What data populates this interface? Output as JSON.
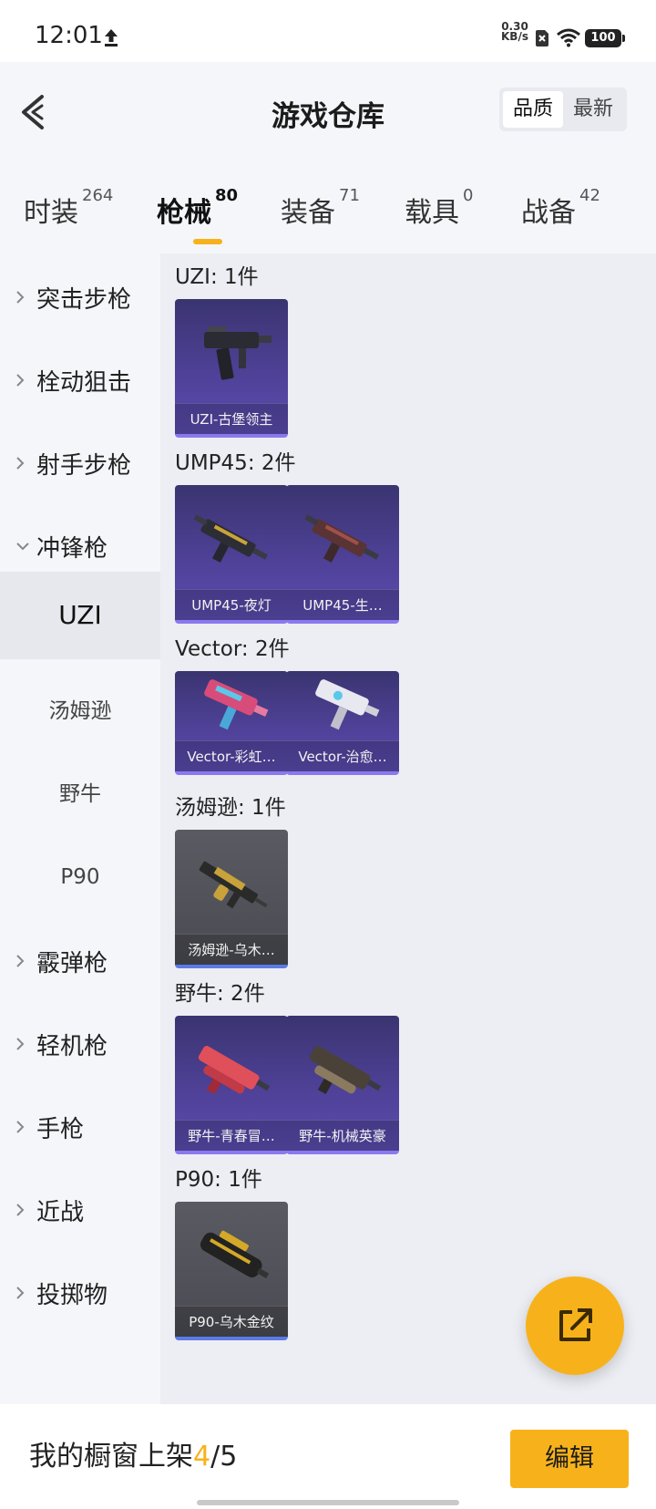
{
  "status_bar": {
    "time": "12:01",
    "net_speed_value": "0.30",
    "net_speed_unit": "KB/s",
    "battery": "100"
  },
  "header": {
    "title": "游戏仓库",
    "sort_options": [
      "品质",
      "最新"
    ],
    "sort_active": "品质"
  },
  "category_tabs": [
    {
      "label": "时装",
      "count": "264",
      "active": false
    },
    {
      "label": "枪械",
      "count": "80",
      "active": true
    },
    {
      "label": "装备",
      "count": "71",
      "active": false
    },
    {
      "label": "载具",
      "count": "0",
      "active": false
    },
    {
      "label": "战备",
      "count": "42",
      "active": false
    }
  ],
  "sidebar": {
    "groups": [
      {
        "label": "突击步枪",
        "expanded": false
      },
      {
        "label": "栓动狙击",
        "expanded": false
      },
      {
        "label": "射手步枪",
        "expanded": false
      },
      {
        "label": "冲锋枪",
        "expanded": true
      },
      {
        "label": "霰弹枪",
        "expanded": false
      },
      {
        "label": "轻机枪",
        "expanded": false
      },
      {
        "label": "手枪",
        "expanded": false
      },
      {
        "label": "近战",
        "expanded": false
      },
      {
        "label": "投掷物",
        "expanded": false
      }
    ],
    "subitems": [
      {
        "label": "UZI",
        "active": true
      },
      {
        "label": "汤姆逊",
        "active": false
      },
      {
        "label": "野牛",
        "active": false
      },
      {
        "label": "P90",
        "active": false
      }
    ]
  },
  "groups": [
    {
      "title": "UZI: 1件",
      "items": [
        {
          "name": "UZI-古堡领主",
          "rarity": "purple",
          "tint": "#2b2b33"
        }
      ]
    },
    {
      "title": "UMP45: 2件",
      "items": [
        {
          "name": "UMP45-夜灯",
          "rarity": "purple",
          "tint": "#c9a43a"
        },
        {
          "name": "UMP45-生…",
          "rarity": "purple",
          "tint": "#a0504a"
        }
      ]
    },
    {
      "title": "Vector: 2件",
      "items": [
        {
          "name": "Vector-彩虹…",
          "rarity": "purple",
          "tint": "#d84c7a"
        },
        {
          "name": "Vector-治愈…",
          "rarity": "purple",
          "tint": "#e8e8f0"
        }
      ]
    },
    {
      "title": "汤姆逊: 1件",
      "items": [
        {
          "name": "汤姆逊-乌木…",
          "rarity": "gray",
          "tint": "#c8a23a"
        }
      ]
    },
    {
      "title": "野牛: 2件",
      "items": [
        {
          "name": "野牛-青春冒…",
          "rarity": "purple",
          "tint": "#e0505a"
        },
        {
          "name": "野牛-机械英豪",
          "rarity": "purple",
          "tint": "#8a7a60"
        }
      ]
    },
    {
      "title": "P90: 1件",
      "items": [
        {
          "name": "P90-乌木金纹",
          "rarity": "gray",
          "tint": "#d4a828"
        }
      ]
    }
  ],
  "fab_icon": "external-link-icon",
  "bottom_bar": {
    "shelf_prefix": "我的橱窗上架",
    "shelf_used": "4",
    "shelf_total": "/5",
    "edit_label": "编辑"
  },
  "colors": {
    "accent": "#f7b21b",
    "purple_card": "#50429a",
    "gray_card": "#4a4b52"
  }
}
